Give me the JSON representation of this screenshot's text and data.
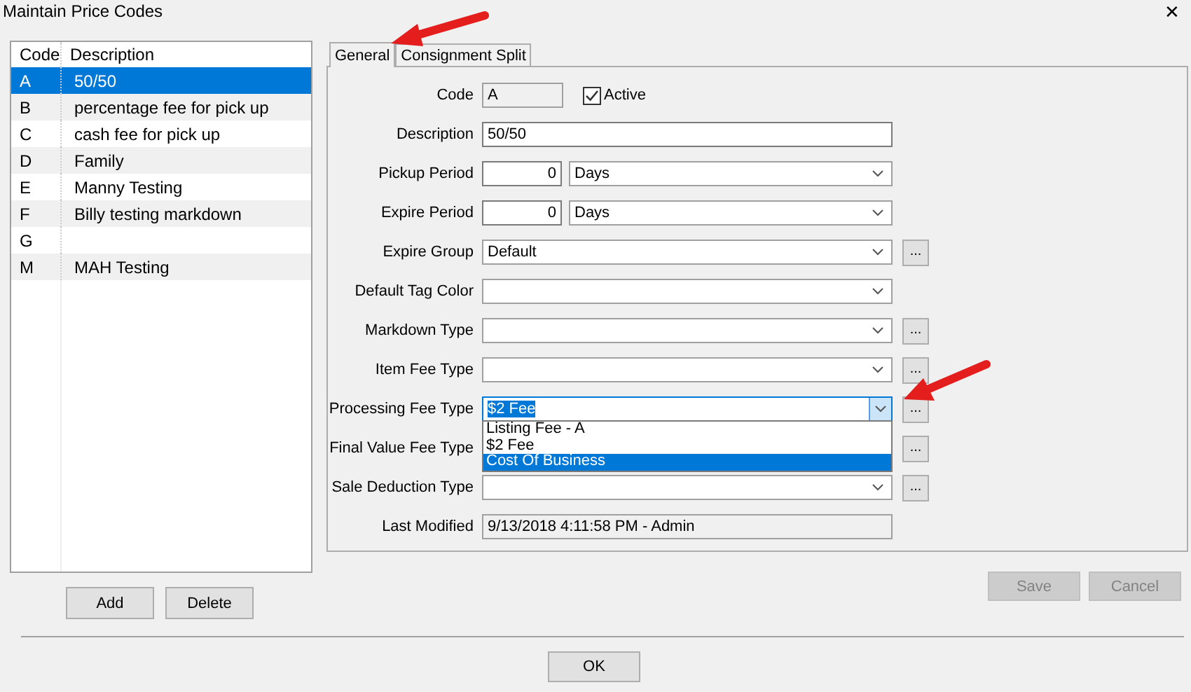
{
  "window": {
    "title": "Maintain Price Codes",
    "close": "✕"
  },
  "list": {
    "columns": [
      "Code",
      "Description"
    ],
    "rows": [
      {
        "code": "A",
        "description": "50/50",
        "selected": true
      },
      {
        "code": "B",
        "description": "percentage fee for pick up",
        "selected": false
      },
      {
        "code": "C",
        "description": "cash fee for pick up",
        "selected": false
      },
      {
        "code": "D",
        "description": "Family",
        "selected": false
      },
      {
        "code": "E",
        "description": "Manny Testing",
        "selected": false
      },
      {
        "code": "F",
        "description": "Billy testing markdown",
        "selected": false
      },
      {
        "code": "G",
        "selected": false
      },
      {
        "code": "M",
        "description": "MAH Testing",
        "selected": false
      }
    ]
  },
  "tabs": [
    {
      "label": "General",
      "selected": true
    },
    {
      "label": "Consignment Split",
      "selected": false
    }
  ],
  "form": {
    "fields": [
      {
        "label": "Code",
        "kind": "readonly",
        "value": "A",
        "checkbox": {
          "label": "Active",
          "checked": true
        }
      },
      {
        "label": "Description",
        "kind": "text",
        "value": "50/50"
      },
      {
        "label": "Pickup Period",
        "kind": "number_combo",
        "value": "0",
        "unit": "Days"
      },
      {
        "label": "Expire Period",
        "kind": "number_combo",
        "value": "0",
        "unit": "Days"
      },
      {
        "label": "Expire Group",
        "kind": "combo",
        "value": "Default",
        "browse": "..."
      },
      {
        "label": "Default Tag Color",
        "kind": "combo"
      },
      {
        "label": "Markdown Type",
        "kind": "combo",
        "browse": "..."
      },
      {
        "label": "Item Fee Type",
        "kind": "combo",
        "browse": "..."
      },
      {
        "label": "Processing Fee Type",
        "kind": "combo",
        "value": "$2 Fee",
        "browse": "...",
        "expanded": true,
        "options": [
          {
            "label": "Listing Fee - A",
            "highlighted": false
          },
          {
            "label": "$2 Fee",
            "highlighted": false
          },
          {
            "label": "Cost Of Business",
            "highlighted": true
          }
        ]
      },
      {
        "label": "Final Value Fee Type",
        "kind": "covered",
        "browse": "..."
      },
      {
        "label": "Sale Deduction Type",
        "kind": "combo",
        "browse": "..."
      },
      {
        "label": "Last Modified",
        "kind": "readonly",
        "value": "9/13/2018 4:11:58 PM - Admin"
      }
    ]
  },
  "list_buttons": [
    {
      "label": "Add",
      "disabled": false
    },
    {
      "label": "Delete",
      "disabled": false
    }
  ],
  "form_buttons": [
    {
      "label": "Save",
      "disabled": true
    },
    {
      "label": "Cancel",
      "disabled": true
    }
  ],
  "ok_button": {
    "label": "OK"
  }
}
